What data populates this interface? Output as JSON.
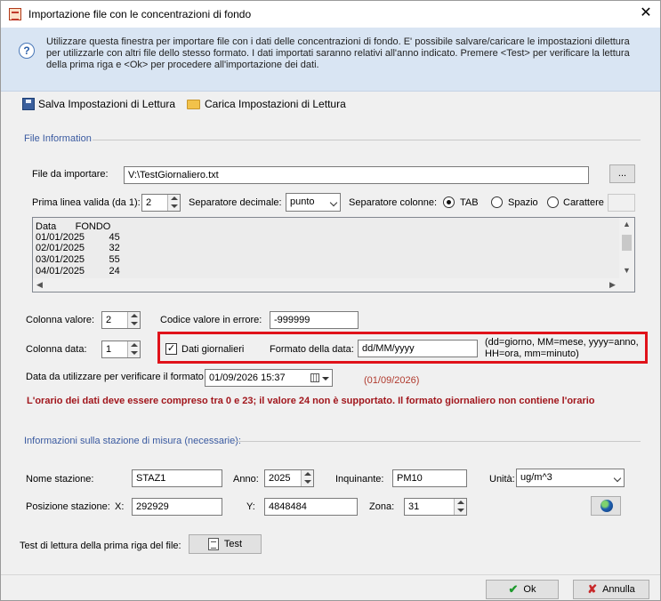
{
  "window": {
    "title": "Importazione file con le concentrazioni di fondo",
    "close_symbol": "✕"
  },
  "info": {
    "text": "Utilizzare questa finestra per importare file con i dati delle concentrazioni di fondo. E' possibile salvare/caricare le impostazioni dilettura per utilizzarle con altri file dello stesso formato. I dati importati saranno relativi all'anno indicato. Premere <Test> per verificare la lettura della prima riga e <Ok> per procedere all'importazione dei dati."
  },
  "toolbar": {
    "save_label": "Salva Impostazioni di Lettura",
    "load_label": "Carica Impostazioni di Lettura"
  },
  "file_info": {
    "group_label": "File Information",
    "file_label": "File da importare:",
    "file_value": "V:\\TestGiornaliero.txt",
    "browse_label": "...",
    "first_line_label": "Prima linea valida (da 1):",
    "first_line_value": "2",
    "decimal_sep_label": "Separatore decimale:",
    "decimal_sep_value": "punto",
    "col_sep_label": "Separatore colonne:",
    "col_sep_options": [
      "TAB",
      "Spazio",
      "Carattere"
    ],
    "col_sep_selected": "TAB",
    "preview_lines": [
      "Data       FONDO",
      "01/01/2025         45",
      "02/01/2025         32",
      "03/01/2025         55",
      "04/01/2025         24"
    ],
    "value_col_label": "Colonna valore:",
    "value_col_value": "2",
    "error_code_label": "Codice valore in errore:",
    "error_code_value": "-999999",
    "date_col_label": "Colonna data:",
    "date_col_value": "1",
    "daily_label": "Dati giornalieri",
    "daily_checked": true,
    "date_format_label": "Formato della data:",
    "date_format_value": "dd/MM/yyyy",
    "date_format_hint": "(dd=giorno, MM=mese, yyyy=anno, HH=ora, mm=minuto)",
    "verify_date_label": "Data da utilizzare per verificare il formato",
    "verify_date_value": "01/09/2026 15:37",
    "verify_date_result": "(01/09/2026)",
    "error_message": "L'orario dei dati deve essere compreso tra 0 e 23; il valore 24 non è supportato. Il formato giornaliero non contiene l'orario"
  },
  "station": {
    "group_label": "Informazioni sulla stazione di misura (necessarie):",
    "name_label": "Nome stazione:",
    "name_value": "STAZ1",
    "year_label": "Anno:",
    "year_value": "2025",
    "pollutant_label": "Inquinante:",
    "pollutant_value": "PM10",
    "unit_label": "Unità:",
    "unit_value": "ug/m^3",
    "position_label": "Posizione stazione:",
    "x_label": "X:",
    "x_value": "292929",
    "y_label": "Y:",
    "y_value": "4848484",
    "zone_label": "Zona:",
    "zone_value": "31"
  },
  "test": {
    "label": "Test di lettura della prima riga del file:",
    "button_label": "Test"
  },
  "footer": {
    "ok_label": "Ok",
    "cancel_label": "Annulla"
  },
  "colors": {
    "accent_group": "#3a5aa0",
    "error_red": "#a1161c",
    "highlight_box": "#e0121a",
    "info_band": "#d9e5f3"
  }
}
